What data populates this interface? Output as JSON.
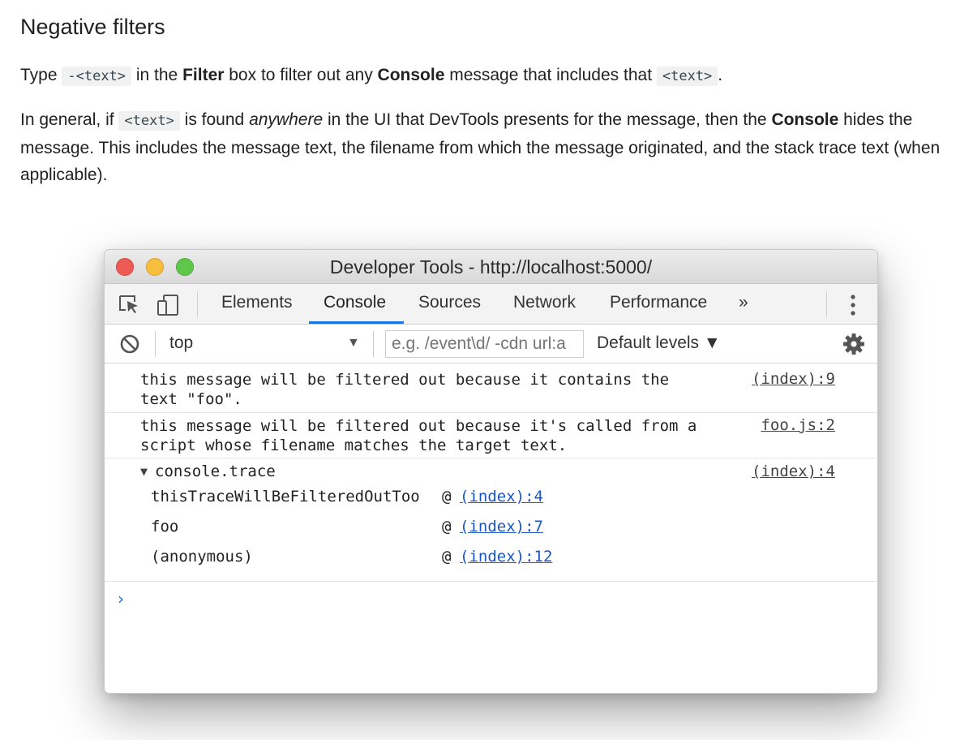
{
  "doc": {
    "heading": "Negative filters",
    "p1": {
      "a": "Type ",
      "code1": "-<text>",
      "b": " in the ",
      "filter": "Filter",
      "c": " box to filter out any ",
      "console": "Console",
      "d": " message that includes that ",
      "code2": "<text>",
      "e": "."
    },
    "p2": {
      "a": "In general, if ",
      "code": "<text>",
      "b": " is found ",
      "anywhere": "anywhere",
      "c": " in the UI that DevTools presents for the message, then the ",
      "console": "Console",
      "d": " hides the message. This includes the message text, the filename from which the message originated, and the stack trace text (when applicable)."
    }
  },
  "devtools": {
    "window_title": "Developer Tools - http://localhost:5000/",
    "tabs": [
      "Elements",
      "Console",
      "Sources",
      "Network",
      "Performance"
    ],
    "more_tabs": "»",
    "active_tab": "Console",
    "context": "top",
    "filter_placeholder": "e.g. /event\\d/ -cdn url:a",
    "levels": "Default levels ▼",
    "messages": [
      {
        "text": "this message will be filtered out because it contains the\ntext \"foo\".",
        "source": "(index):9"
      },
      {
        "text": "this message will be filtered out because it's called from a\nscript whose filename matches the target text.",
        "source": "foo.js:2"
      }
    ],
    "trace": {
      "label": "console.trace",
      "source": "(index):4",
      "frames": [
        {
          "fn": "thisTraceWillBeFilteredOutToo",
          "at": "@",
          "link": "(index):4"
        },
        {
          "fn": "foo",
          "at": "@",
          "link": "(index):7"
        },
        {
          "fn": "(anonymous)",
          "at": "@",
          "link": "(index):12"
        }
      ]
    },
    "prompt": "›"
  },
  "colors": {
    "accent": "#1a73e8",
    "link": "#1a55c5",
    "close": "#ee5b55",
    "minimize": "#f6be3d",
    "zoom": "#5fc84a"
  },
  "icons": [
    "inspect-element-icon",
    "device-toolbar-icon",
    "clear-console-icon",
    "dropdown-arrow-icon",
    "settings-gear-icon",
    "kebab-menu-icon",
    "disclosure-triangle-icon",
    "console-prompt-icon"
  ]
}
